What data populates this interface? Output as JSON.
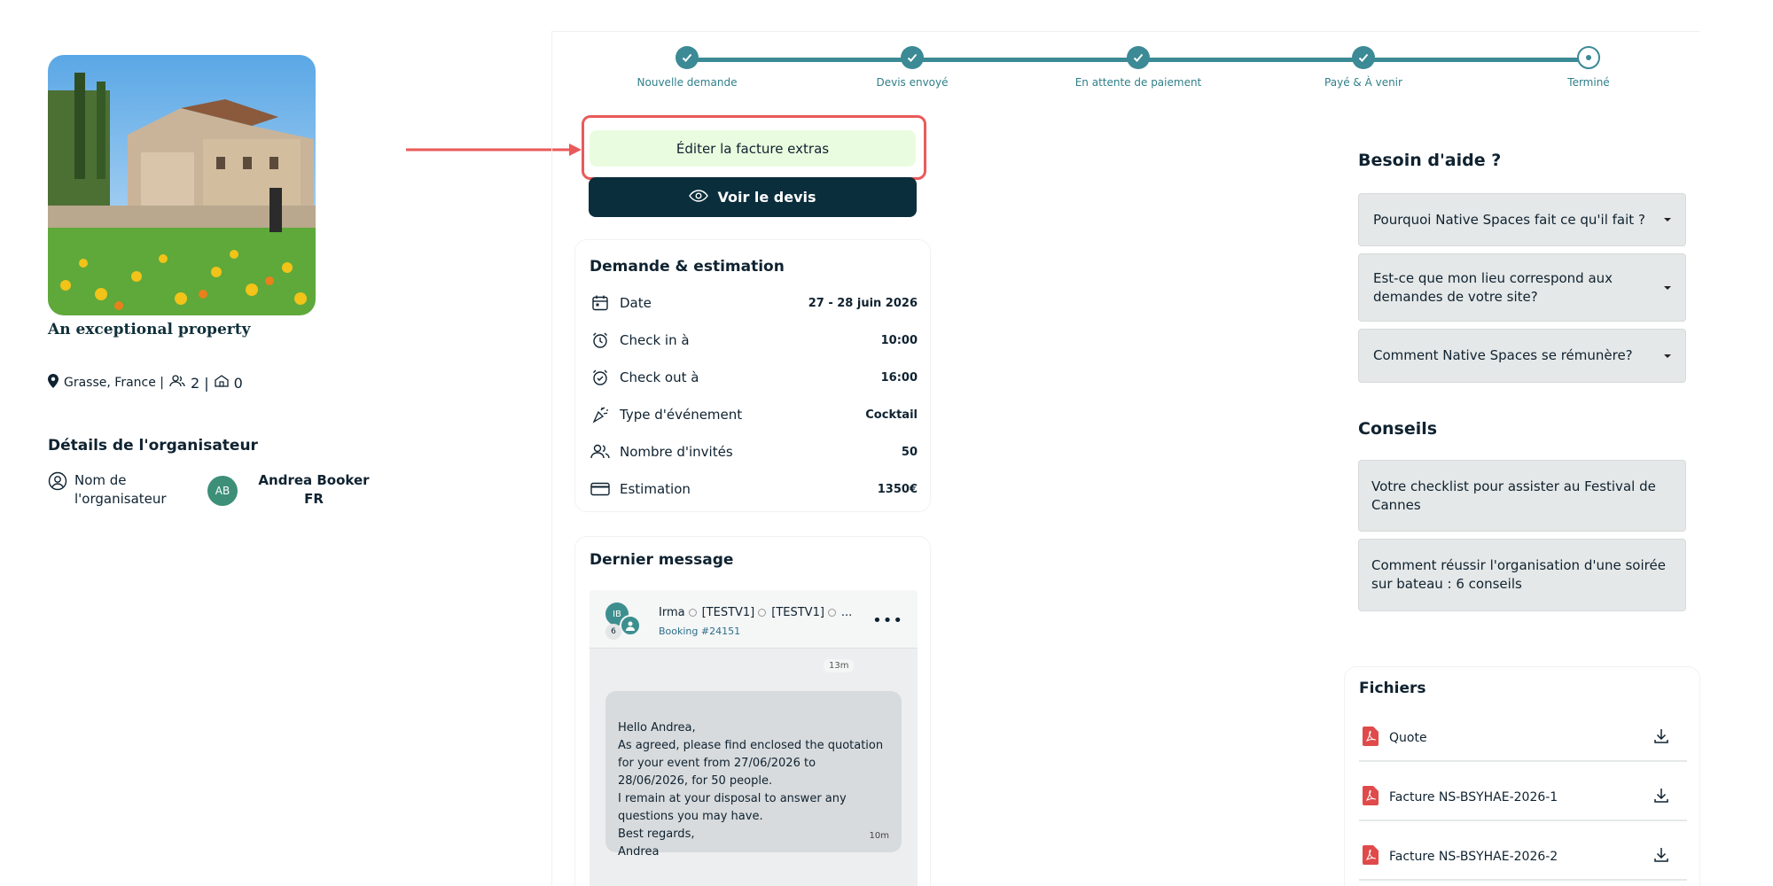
{
  "property": {
    "title": "An exceptional property",
    "location": "Grasse, France |",
    "guests": "2 |",
    "rooms": "0"
  },
  "organizer": {
    "section_title": "Détails de l'organisateur",
    "label": "Nom de l'organisateur",
    "avatar_initials": "AB",
    "name": "Andrea Booker FR"
  },
  "stepper": {
    "steps": [
      {
        "label": "Nouvelle demande",
        "state": "done"
      },
      {
        "label": "Devis envoyé",
        "state": "done"
      },
      {
        "label": "En attente de paiement",
        "state": "done"
      },
      {
        "label": "Payé & À venir",
        "state": "done"
      },
      {
        "label": "Terminé",
        "state": "current"
      }
    ],
    "accent_color": "#3b8a95"
  },
  "actions": {
    "edit_extras_label": "Éditer la facture extras",
    "view_quote_label": "Voir le devis"
  },
  "estimate": {
    "title": "Demande & estimation",
    "rows": [
      {
        "icon": "calendar-icon",
        "label": "Date",
        "value": "27 - 28 juin 2026"
      },
      {
        "icon": "alarm-clock-icon",
        "label": "Check in à",
        "value": "10:00"
      },
      {
        "icon": "alarm-clock-icon",
        "label": "Check out à",
        "value": "16:00"
      },
      {
        "icon": "party-popper-icon",
        "label": "Type d'événement",
        "value": "Cocktail"
      },
      {
        "icon": "users-icon",
        "label": "Nombre d'invités",
        "value": "50"
      },
      {
        "icon": "credit-card-icon",
        "label": "Estimation",
        "value": "1350€"
      }
    ]
  },
  "last_message": {
    "title": "Dernier message",
    "avatar_initials": "IB",
    "participant_count": "6",
    "participants": [
      "Irma",
      "[TESTV1]",
      "[TESTV1]",
      "..."
    ],
    "booking_ref": "Booking #24151",
    "time_divider": "13m",
    "body": "Hello Andrea,\nAs agreed, please find enclosed the quotation for your event from 27/06/2026 to 28/06/2026, for 50 people.\nI remain at your disposal to answer any questions you may have.\nBest regards,\nAndrea",
    "body_time": "10m"
  },
  "help": {
    "title": "Besoin d'aide ?",
    "items": [
      "Pourquoi Native Spaces fait ce qu'il fait ?",
      "Est-ce que mon lieu correspond aux demandes de votre site?",
      "Comment Native Spaces se rémunère?"
    ]
  },
  "tips": {
    "title": "Conseils",
    "items": [
      "Votre checklist pour assister au Festival de Cannes",
      "Comment réussir l'organisation d'une soirée sur bateau : 6 conseils"
    ]
  },
  "files": {
    "title": "Fichiers",
    "items": [
      "Quote",
      "Facture NS-BSYHAE-2026-1",
      "Facture NS-BSYHAE-2026-2"
    ]
  },
  "colors": {
    "dark_button": "#0b2e3c",
    "extras_button": "#eafcdf",
    "highlight": "#ea5a5a",
    "pdf": "#e04a4a"
  }
}
